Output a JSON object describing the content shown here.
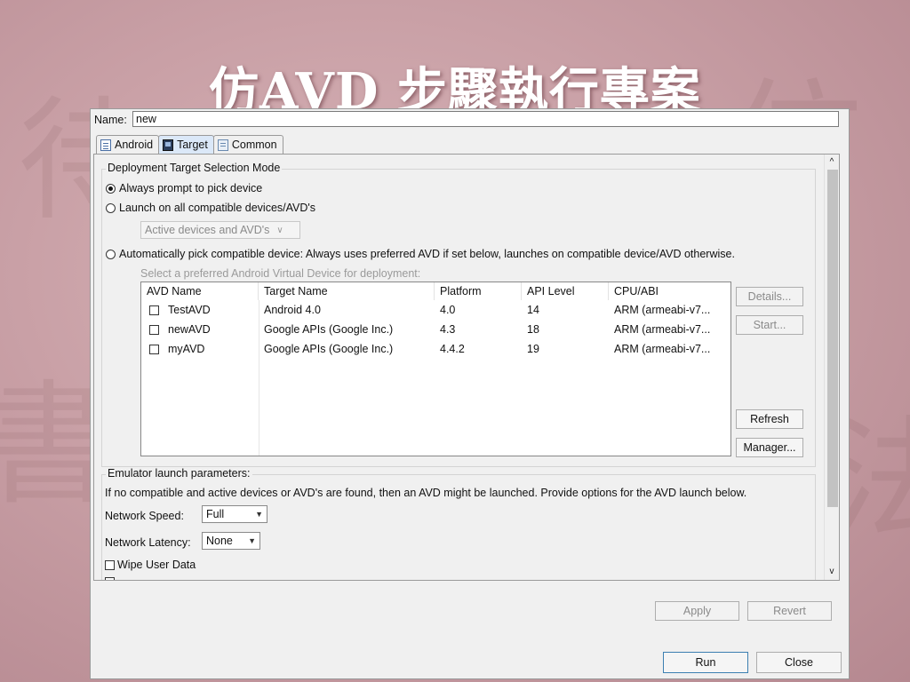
{
  "slide": {
    "title": "仿AVD 步驟執行專案"
  },
  "name_field": {
    "label": "Name:",
    "value": "new"
  },
  "tabs": [
    {
      "label": "Android",
      "icon": "document-icon",
      "active": false
    },
    {
      "label": "Target",
      "icon": "target-device-icon",
      "active": true
    },
    {
      "label": "Common",
      "icon": "common-list-icon",
      "active": false
    }
  ],
  "deployment": {
    "group_title": "Deployment Target Selection Mode",
    "option_prompt": "Always prompt to pick device",
    "option_launch_all": "Launch on all compatible devices/AVD's",
    "launch_all_combo": "Active devices and AVD's",
    "option_auto": "Automatically pick compatible device: Always uses preferred AVD if set below, launches on compatible device/AVD otherwise.",
    "auto_hint": "Select a preferred Android Virtual Device for deployment:",
    "selected_option": "prompt"
  },
  "avd_table": {
    "headers": [
      "AVD Name",
      "Target Name",
      "Platform",
      "API Level",
      "CPU/ABI"
    ],
    "rows": [
      [
        "TestAVD",
        "Android 4.0",
        "4.0",
        "14",
        "ARM (armeabi-v7..."
      ],
      [
        "newAVD",
        "Google APIs (Google Inc.)",
        "4.3",
        "18",
        "ARM (armeabi-v7..."
      ],
      [
        "myAVD",
        "Google APIs (Google Inc.)",
        "4.4.2",
        "19",
        "ARM (armeabi-v7..."
      ]
    ]
  },
  "side_buttons": {
    "details": "Details...",
    "start": "Start...",
    "refresh": "Refresh",
    "manager": "Manager..."
  },
  "emulator": {
    "group_title": "Emulator launch parameters:",
    "description": "If no compatible and active devices or AVD's are found, then an AVD might be launched. Provide options for the AVD launch below.",
    "network_speed_label": "Network Speed:",
    "network_speed_value": "Full",
    "network_latency_label": "Network Latency:",
    "network_latency_value": "None",
    "wipe_user_data": "Wipe User Data"
  },
  "footer": {
    "apply": "Apply",
    "revert": "Revert",
    "run": "Run",
    "close": "Close"
  }
}
